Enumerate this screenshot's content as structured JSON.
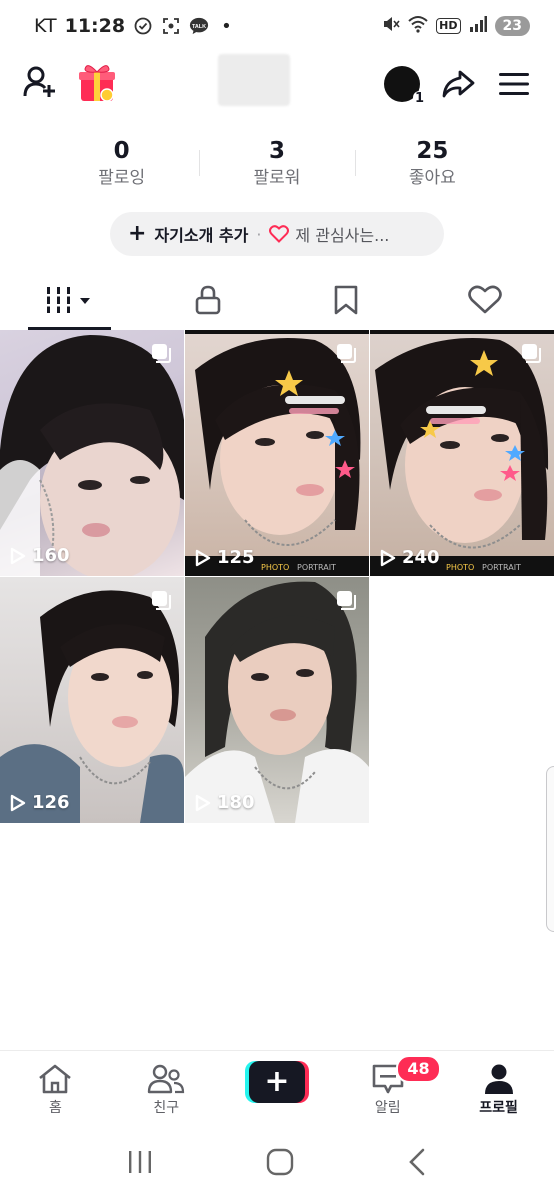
{
  "status_bar": {
    "carrier": "KT",
    "time": "11:28",
    "talk_label": "TALK",
    "hd_label": "HD",
    "battery": "23"
  },
  "header": {
    "notification_badge_count": "1"
  },
  "stats": [
    {
      "value": "0",
      "label": "팔로잉"
    },
    {
      "value": "3",
      "label": "팔로워"
    },
    {
      "value": "25",
      "label": "좋아요"
    }
  ],
  "bio": {
    "plus": "+",
    "add_label": "자기소개 추가",
    "separator": "·",
    "interest_label": "제 관심사는..."
  },
  "tabs": [
    {
      "icon": "grid-videos-icon",
      "active": true
    },
    {
      "icon": "lock-icon",
      "active": false
    },
    {
      "icon": "bookmark-icon",
      "active": false
    },
    {
      "icon": "heart-icon",
      "active": false
    }
  ],
  "videos": [
    {
      "views": "160"
    },
    {
      "views": "125",
      "photo_label": "PHOTO",
      "portrait_label": "PORTRAIT"
    },
    {
      "views": "240",
      "photo_label": "PHOTO",
      "portrait_label": "PORTRAIT"
    },
    {
      "views": "126"
    },
    {
      "views": "180"
    }
  ],
  "bottom_nav": {
    "home": "홈",
    "friends": "친구",
    "create": "+",
    "inbox": "알림",
    "inbox_badge": "48",
    "profile": "프로필"
  },
  "colors": {
    "accent": "#fe2c55",
    "cyan": "#25f4ee",
    "text": "#161823"
  }
}
